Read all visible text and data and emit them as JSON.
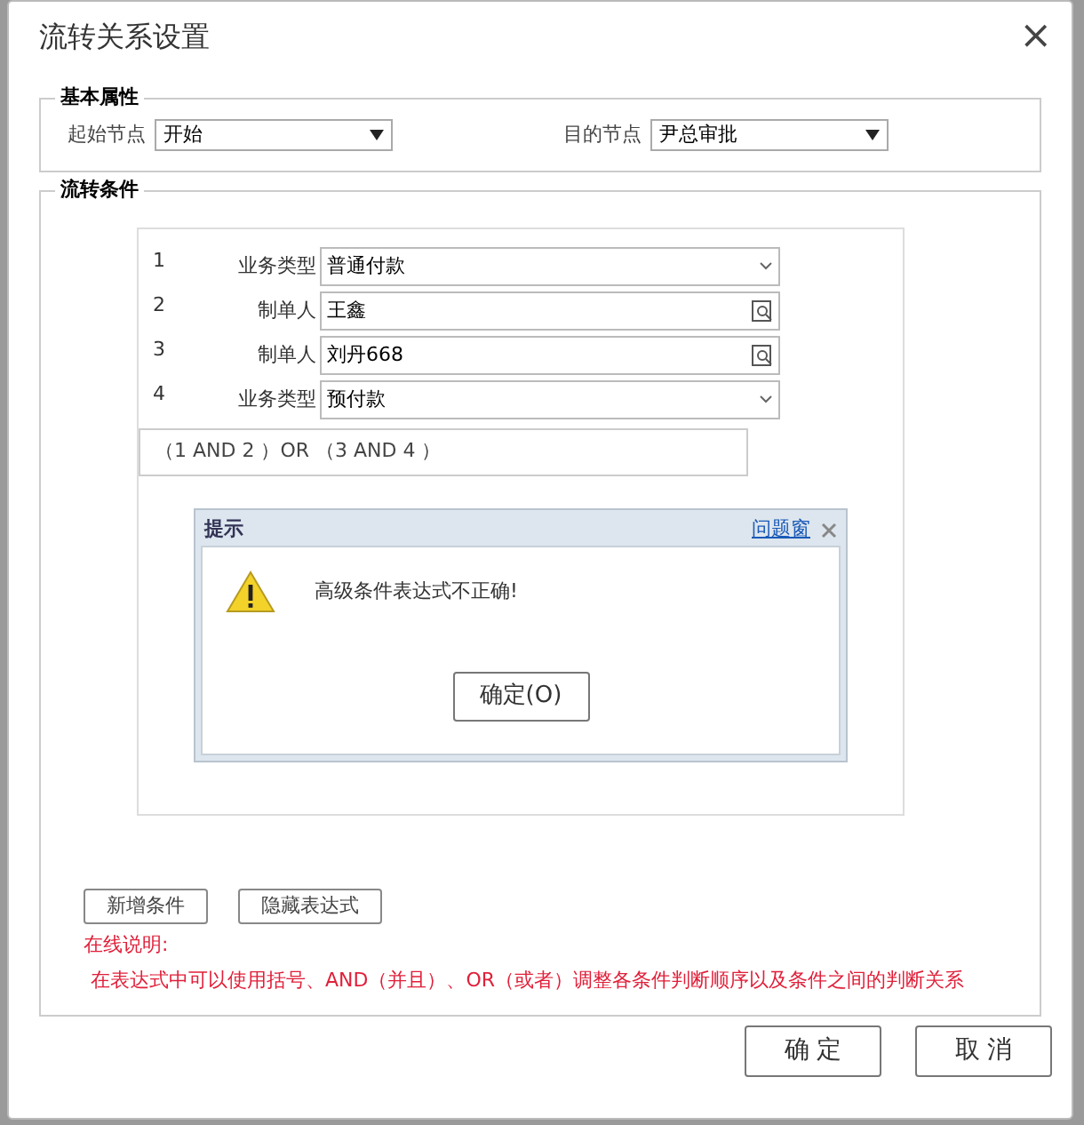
{
  "window": {
    "title": "流转关系设置",
    "close": "×"
  },
  "basic": {
    "legend": "基本属性",
    "fields": [
      {
        "label": "起始节点",
        "value": "开始"
      },
      {
        "label": "目的节点",
        "value": "尹总审批"
      }
    ]
  },
  "flow": {
    "legend": "流转条件",
    "conditions": [
      {
        "index": "1",
        "label": "业务类型",
        "value": "普通付款",
        "kind": "select"
      },
      {
        "index": "2",
        "label": "制单人",
        "value": "王鑫",
        "kind": "lookup"
      },
      {
        "index": "3",
        "label": "制单人",
        "value": "刘丹668",
        "kind": "lookup"
      },
      {
        "index": "4",
        "label": "业务类型",
        "value": "预付款",
        "kind": "select"
      }
    ],
    "expression": "（1 AND 2 ）OR （3  AND 4 ）",
    "alert": {
      "title": "提示",
      "link": "问题窗",
      "message": "高级条件表达式不正确!",
      "button": "确定(O)"
    },
    "buttons": [
      "新增条件",
      "隐藏表达式"
    ],
    "help_title": "在线说明:",
    "help_text": "在表达式中可以使用括号、AND（并且）、OR（或者）调整各条件判断顺序以及条件之间的判断关系"
  },
  "footer_buttons": [
    "确 定",
    "取 消"
  ]
}
